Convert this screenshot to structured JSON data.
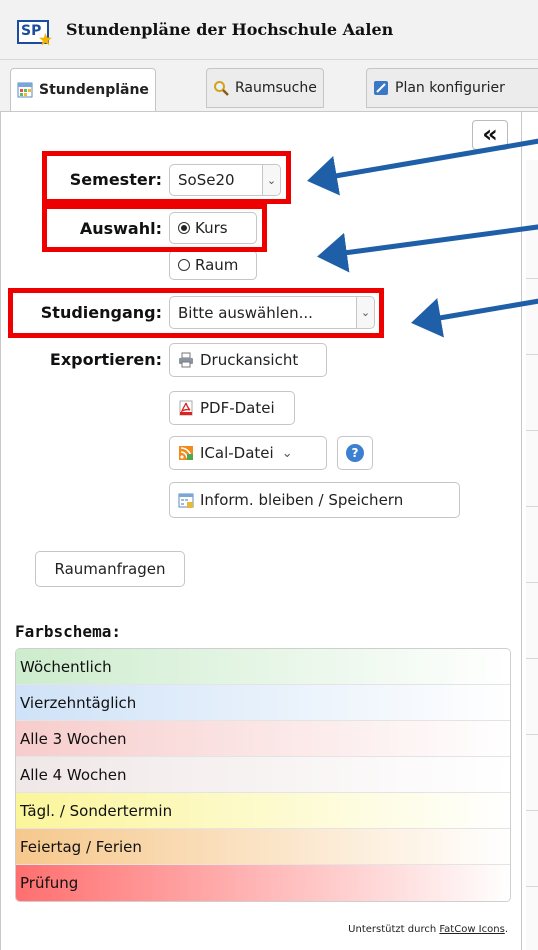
{
  "app": {
    "logo_text": "SP",
    "title": "Stundenpläne der Hochschule Aalen"
  },
  "tabs": [
    {
      "label": "Stundenpläne",
      "icon": "calendar-grid-icon",
      "active": true
    },
    {
      "label": "Raumsuche",
      "icon": "magnifier-icon",
      "active": false
    },
    {
      "label": "Plan konfigurier",
      "icon": "pencil-icon",
      "active": false
    }
  ],
  "collapse": {
    "label": "«"
  },
  "form": {
    "semester_label": "Semester:",
    "semester_value": "SoSe20",
    "auswahl_label": "Auswahl:",
    "option_kurs": "Kurs",
    "option_raum": "Raum",
    "selected_option": "Kurs",
    "studiengang_label": "Studiengang:",
    "studiengang_value": "Bitte auswählen...",
    "export_label": "Exportieren:"
  },
  "export": {
    "print": "Druckansicht",
    "pdf": "PDF-Datei",
    "ical": "ICal-Datei",
    "subscribe": "Inform. bleiben / Speichern",
    "help_symbol": "?"
  },
  "room_request": "Raumanfragen",
  "color_scheme": {
    "title": "Farbschema:",
    "items": [
      {
        "label": "Wöchentlich",
        "from": "#cdeccd",
        "to": "#ffffff"
      },
      {
        "label": "Vierzehntäglich",
        "from": "#cfe2f7",
        "to": "#ffffff"
      },
      {
        "label": "Alle 3 Wochen",
        "from": "#f7cccc",
        "to": "#ffffff"
      },
      {
        "label": "Alle 4 Wochen",
        "from": "#f0e7e7",
        "to": "#ffffff"
      },
      {
        "label": "Tägl. / Sondertermin",
        "from": "#fbf59a",
        "to": "#ffffff"
      },
      {
        "label": "Feiertag / Ferien",
        "from": "#f6c88c",
        "to": "#ffffff"
      },
      {
        "label": "Prüfung",
        "from": "#ff6f6f",
        "to": "#ffffff"
      }
    ]
  },
  "credit": {
    "text": "Unterstützt durch ",
    "link": "FatCow Icons",
    "suffix": "."
  },
  "annotation_colors": {
    "highlight": "#ee0000",
    "arrow": "#1f5fa8"
  }
}
